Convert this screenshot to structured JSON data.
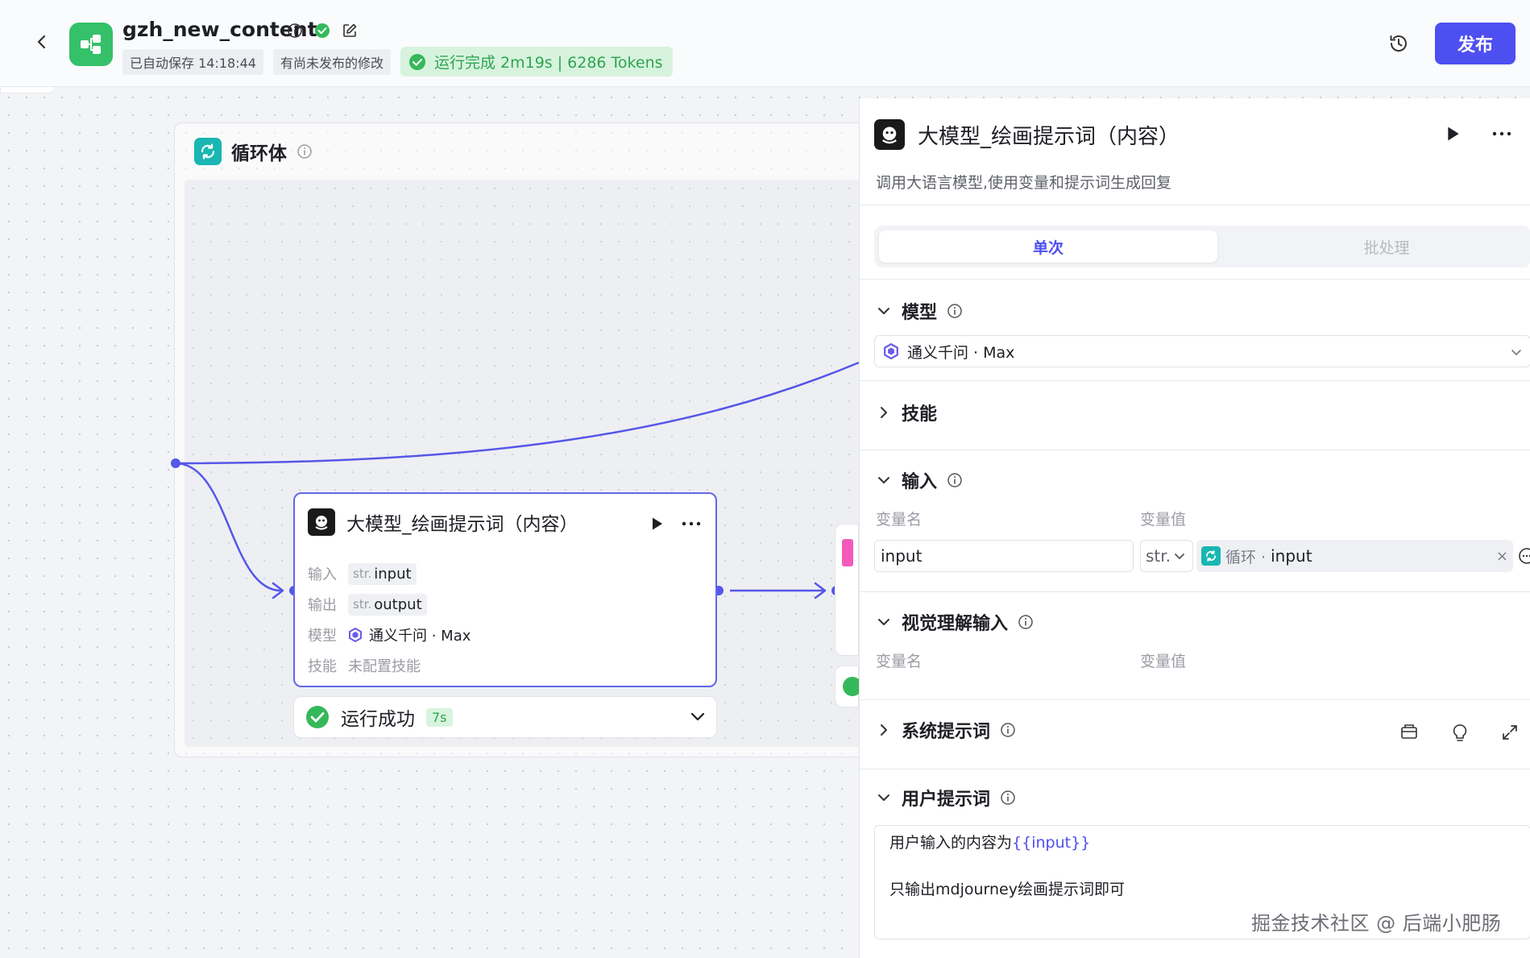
{
  "header": {
    "app_name": "gzh_new_content",
    "autosave": "已自动保存 14:18:44",
    "unpublished": "有尚未发布的修改",
    "run_status": "运行完成 2m19s | 6286 Tokens",
    "publish_label": "发布"
  },
  "canvas": {
    "loop": {
      "title": "循环体"
    },
    "node": {
      "title": "大模型_绘画提示词（内容）",
      "rows": [
        {
          "label": "输入",
          "type": "str.",
          "value": "input"
        },
        {
          "label": "输出",
          "type": "str.",
          "value": "output"
        },
        {
          "label": "模型",
          "value": "通义千问 · Max"
        },
        {
          "label": "技能",
          "value": "未配置技能"
        }
      ],
      "status": {
        "text": "运行成功",
        "time": "7s"
      }
    }
  },
  "panel": {
    "title": "大模型_绘画提示词（内容）",
    "description": "调用大语言模型,使用变量和提示词生成回复",
    "tabs": [
      {
        "label": "单次",
        "active": true
      },
      {
        "label": "批处理",
        "active": false
      }
    ],
    "model_section": {
      "title": "模型",
      "selected": "通义千问 · Max"
    },
    "skills_section": {
      "title": "技能"
    },
    "input_section": {
      "title": "输入",
      "col_name": "变量名",
      "col_value": "变量值",
      "var_name": "input",
      "var_type": "str.",
      "ref_source": "循环 ·",
      "ref_var": "input"
    },
    "vision_section": {
      "title": "视觉理解输入",
      "col_name": "变量名",
      "col_value": "变量值"
    },
    "system_prompt": {
      "title": "系统提示词"
    },
    "user_prompt": {
      "title": "用户提示词",
      "line1_text": "用户输入的内容为",
      "line1_var": "{{input}}",
      "line2": "只输出mdjourney绘画提示词即可"
    }
  },
  "watermark": "掘金技术社区 @ 后端小肥肠",
  "colors": {
    "accent": "#4e4ff0",
    "success": "#2fa54f",
    "loop_teal": "#19b6b2",
    "app_green": "#35c06a"
  }
}
